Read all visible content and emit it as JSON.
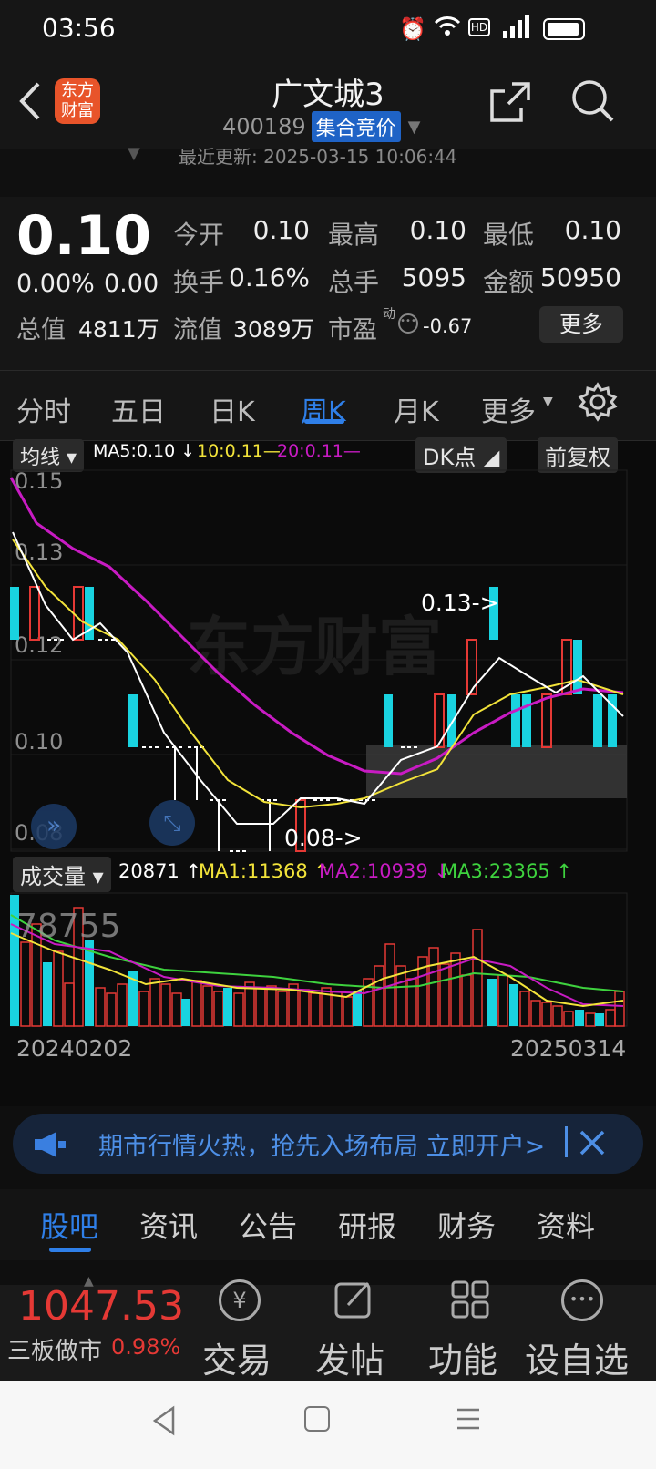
{
  "status": {
    "time": "03:56"
  },
  "header": {
    "logo": "东方财富",
    "title": "广文城3",
    "code": "400189",
    "badge": "集合竞价"
  },
  "update": {
    "text": "最近更新: 2025-03-15 10:06:44"
  },
  "quote": {
    "price": "0.10",
    "pct": "0.00%",
    "chg": "0.00",
    "total_value_label": "总值",
    "total_value": "4811万",
    "float_value_label": "流值",
    "float_value": "3089万",
    "pe_label": "市盈",
    "pe_sup": "动",
    "pe": "-0.67",
    "more": "更多",
    "stats": [
      [
        "今开",
        "0.10"
      ],
      [
        "最高",
        "0.10"
      ],
      [
        "最低",
        "0.10"
      ],
      [
        "换手",
        "0.16%"
      ],
      [
        "总手",
        "5095"
      ],
      [
        "金额",
        "50950"
      ]
    ]
  },
  "tabs": [
    "分时",
    "五日",
    "日K",
    "周K",
    "月K",
    "更多"
  ],
  "active_tab": "周K",
  "indicators": {
    "selector": "均线",
    "ma5": "MA5:0.10",
    "ma10": "10:0.11",
    "ma20": "20:0.11",
    "dk": "DK点",
    "adjust": "前复权"
  },
  "price_axis": [
    "0.15",
    "0.13",
    "0.12",
    "0.10",
    "0.08"
  ],
  "annotations": {
    "high": "0.13->",
    "low": "0.08->"
  },
  "volume": {
    "selector": "成交量",
    "value": "20871",
    "ma1": "MA1:11368",
    "ma2": "MA2:10939",
    "ma3": "MA3:23365",
    "max": "78755"
  },
  "dates": {
    "start": "20240202",
    "end": "20250314"
  },
  "banner": {
    "text": "期市行情火热，抢先入场布局 立即开户>"
  },
  "subtabs": [
    "股吧",
    "资讯",
    "公告",
    "研报",
    "财务",
    "资料"
  ],
  "bottom": {
    "index_value": "1047.53",
    "index_name": "三板做市",
    "index_pct": "0.98%",
    "items": [
      "交易",
      "发帖",
      "功能",
      "设自选"
    ]
  },
  "colors": {
    "up": "#e53935",
    "down": "#19d3e0",
    "ma5": "#ffffff",
    "ma10": "#f2e33a",
    "ma20": "#c81bc3",
    "ma3": "#3ed23e",
    "accent": "#2f7fe8"
  }
}
